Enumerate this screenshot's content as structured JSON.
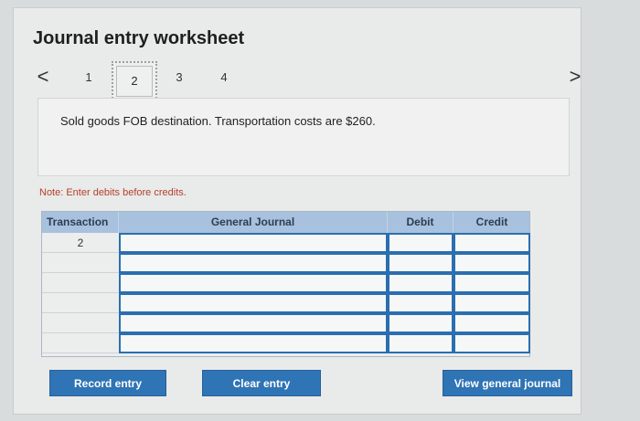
{
  "worksheet": {
    "title": "Journal entry worksheet",
    "pager": {
      "prev": "<",
      "next": ">",
      "pages": [
        "1",
        "2",
        "3",
        "4"
      ],
      "current": "2"
    },
    "description": "Sold goods FOB destination. Transportation costs are $260.",
    "note": "Note: Enter debits before credits."
  },
  "journal": {
    "headers": {
      "transaction": "Transaction",
      "general_journal": "General Journal",
      "debit": "Debit",
      "credit": "Credit"
    },
    "rows": [
      {
        "transaction": "2",
        "general_journal": "",
        "debit": "",
        "credit": ""
      },
      {
        "transaction": "",
        "general_journal": "",
        "debit": "",
        "credit": ""
      },
      {
        "transaction": "",
        "general_journal": "",
        "debit": "",
        "credit": ""
      },
      {
        "transaction": "",
        "general_journal": "",
        "debit": "",
        "credit": ""
      },
      {
        "transaction": "",
        "general_journal": "",
        "debit": "",
        "credit": ""
      },
      {
        "transaction": "",
        "general_journal": "",
        "debit": "",
        "credit": ""
      }
    ]
  },
  "actions": {
    "record_entry": "Record entry",
    "clear_entry": "Clear entry",
    "view_general_journal": "View general journal"
  },
  "colors": {
    "accent": "#2f74b5",
    "header_bg": "#a7c1de",
    "note": "#b5402a"
  }
}
